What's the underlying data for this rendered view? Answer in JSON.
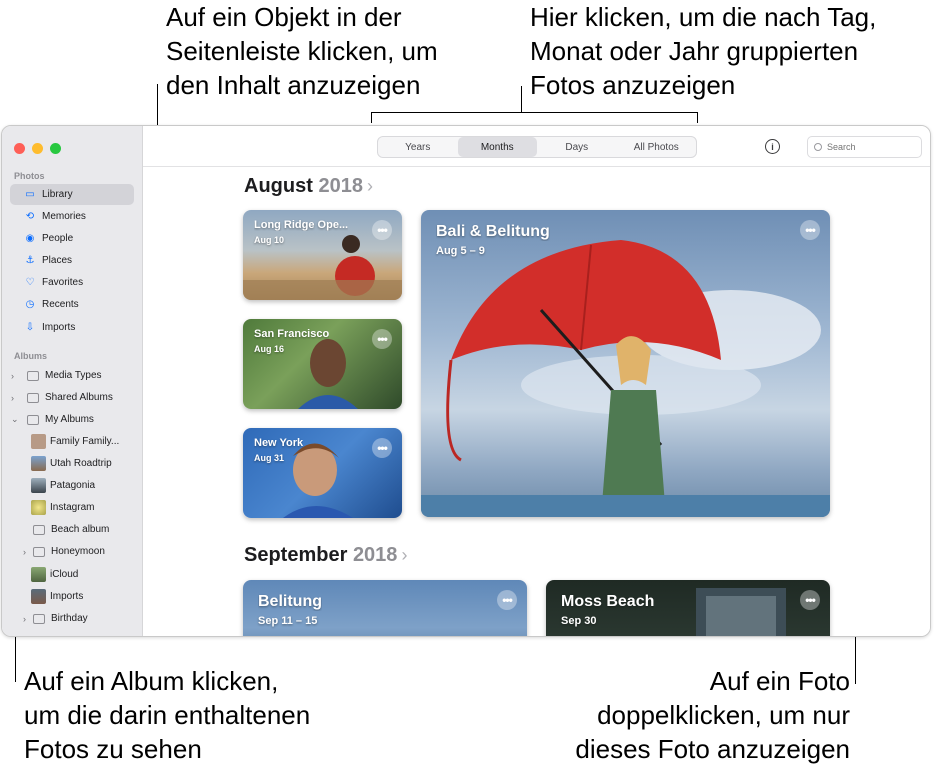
{
  "callouts": {
    "top_left": [
      "Auf ein Objekt in der",
      "Seitenleiste klicken, um",
      "den Inhalt anzuzeigen"
    ],
    "top_right": [
      "Hier klicken, um die nach Tag,",
      "Monat oder Jahr gruppierten",
      "Fotos anzuzeigen"
    ],
    "bottom_left": [
      "Auf ein Album klicken,",
      "um die darin enthaltenen",
      "Fotos zu sehen"
    ],
    "bottom_right": [
      "Auf ein Foto",
      "doppelklicken, um nur",
      "dieses Foto anzuzeigen"
    ]
  },
  "sidebar": {
    "photos_section": "Photos",
    "photos_items": [
      {
        "label": "Library",
        "icon": "library-icon",
        "glyph": "▭"
      },
      {
        "label": "Memories",
        "icon": "memories-icon",
        "glyph": "⟲"
      },
      {
        "label": "People",
        "icon": "people-icon",
        "glyph": "◉"
      },
      {
        "label": "Places",
        "icon": "places-icon",
        "glyph": "⚓"
      },
      {
        "label": "Favorites",
        "icon": "favorites-icon",
        "glyph": "♡"
      },
      {
        "label": "Recents",
        "icon": "recents-icon",
        "glyph": "◷"
      },
      {
        "label": "Imports",
        "icon": "imports-icon",
        "glyph": "⇩"
      }
    ],
    "albums_section": "Albums",
    "album_groups": [
      {
        "label": "Media Types",
        "chevron": "›"
      },
      {
        "label": "Shared Albums",
        "chevron": "›"
      },
      {
        "label": "My Albums",
        "chevron": "⌄"
      }
    ],
    "my_albums": [
      {
        "label": "Family Family...",
        "kind": "thumb",
        "color": "#b79a86"
      },
      {
        "label": "Utah Roadtrip",
        "kind": "thumb",
        "color": "#5d7fa8"
      },
      {
        "label": "Patagonia",
        "kind": "thumb",
        "color": "#4a5560"
      },
      {
        "label": "Instagram",
        "kind": "thumb",
        "color": "#c9c36a"
      },
      {
        "label": "Beach album",
        "kind": "album"
      },
      {
        "label": "Honeymoon",
        "kind": "folder",
        "chevron": "›"
      },
      {
        "label": "iCloud",
        "kind": "thumb",
        "color": "#6e8b5a"
      },
      {
        "label": "Imports",
        "kind": "thumb",
        "color": "#7a5a4a"
      },
      {
        "label": "Birthday",
        "kind": "folder",
        "chevron": "›"
      }
    ]
  },
  "toolbar": {
    "segments": [
      "Years",
      "Months",
      "Days",
      "All Photos"
    ],
    "active_segment": "Months",
    "info_label": "i",
    "search_placeholder": "Search"
  },
  "content": {
    "august": {
      "month": "August",
      "year": "2018",
      "arrow": "›"
    },
    "september": {
      "month": "September",
      "year": "2018",
      "arrow": "›"
    },
    "cards": [
      {
        "title": "Long Ridge Ope...",
        "date": "Aug 10",
        "more": "•••"
      },
      {
        "title": "San Francisco",
        "date": "Aug 16",
        "more": "•••"
      },
      {
        "title": "New York",
        "date": "Aug 31",
        "more": "•••"
      },
      {
        "title": "Bali & Belitung",
        "date": "Aug 5 – 9",
        "more": "•••"
      },
      {
        "title": "Belitung",
        "date": "Sep 11 – 15",
        "more": "•••"
      },
      {
        "title": "Moss Beach",
        "date": "Sep 30",
        "more": "•••"
      }
    ]
  },
  "colors": {
    "accent": "#0a6cff",
    "sidebar_bg": "#e9e9ec",
    "close": "#fe5f57",
    "minimize": "#febc2e",
    "zoom": "#28c840"
  }
}
